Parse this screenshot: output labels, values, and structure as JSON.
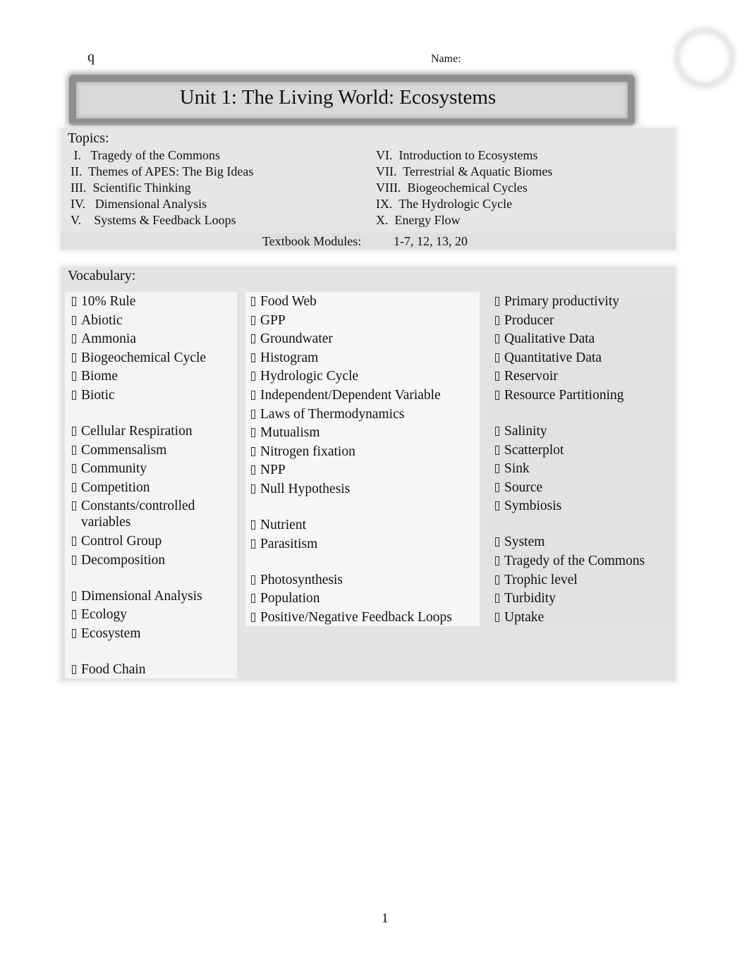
{
  "header": {
    "stray_char": "q",
    "name_label": "Name:",
    "title": "Unit 1: The Living World: Ecosystems"
  },
  "topics": {
    "heading": "Topics:",
    "left": [
      {
        "numeral": " I.",
        "label": "Tragedy of the Commons",
        "sep": "   "
      },
      {
        "numeral": "II.",
        "label": "Themes of APES: The Big Ideas",
        "sep": "  "
      },
      {
        "numeral": "III.",
        "label": "Scientific Thinking",
        "sep": "  "
      },
      {
        "numeral": "IV.",
        "label": "Dimensional Analysis",
        "sep": "   "
      },
      {
        "numeral": "V.",
        "label": "Systems & Feedback Loops",
        "sep": "    "
      }
    ],
    "right": [
      {
        "numeral": "VI.",
        "label": "Introduction to Ecosystems",
        "sep": "  "
      },
      {
        "numeral": "VII.",
        "label": "Terrestrial & Aquatic Biomes",
        "sep": "  "
      },
      {
        "numeral": "VIII.",
        "label": "Biogeochemical Cycles",
        "sep": "  "
      },
      {
        "numeral": "IX.",
        "label": "The Hydrologic Cycle",
        "sep": "  "
      },
      {
        "numeral": "X.",
        "label": "Energy Flow",
        "sep": "  "
      }
    ],
    "modules_label": "Textbook Modules:",
    "modules_value": "1-7, 12, 13, 20"
  },
  "vocabulary": {
    "heading": "Vocabulary:",
    "bullet_icon": "checkbox-icon",
    "columns": [
      [
        {
          "term": "10% Rule"
        },
        {
          "term": "Abiotic"
        },
        {
          "term": "Ammonia"
        },
        {
          "term": "Biogeochemical Cycle"
        },
        {
          "term": "Biome"
        },
        {
          "term": "Biotic",
          "pad": true
        },
        {
          "term": "Cellular Respiration"
        },
        {
          "term": "Commensalism"
        },
        {
          "term": "Community"
        },
        {
          "term": "Competition"
        },
        {
          "term": "Constants/controlled variables"
        },
        {
          "term": "Control Group"
        },
        {
          "term": "Decomposition",
          "pad": true
        },
        {
          "term": "Dimensional Analysis"
        },
        {
          "term": "Ecology"
        },
        {
          "term": "Ecosystem",
          "pad": true
        },
        {
          "term": "Food Chain"
        }
      ],
      [
        {
          "term": "Food Web"
        },
        {
          "term": "GPP"
        },
        {
          "term": "Groundwater"
        },
        {
          "term": "Histogram"
        },
        {
          "term": "Hydrologic Cycle"
        },
        {
          "term": "Independent/Dependent Variable"
        },
        {
          "term": "Laws of Thermodynamics"
        },
        {
          "term": "Mutualism"
        },
        {
          "term": "Nitrogen fixation"
        },
        {
          "term": "NPP"
        },
        {
          "term": "Null Hypothesis",
          "pad": true
        },
        {
          "term": "Nutrient"
        },
        {
          "term": "Parasitism",
          "pad": true
        },
        {
          "term": "Photosynthesis"
        },
        {
          "term": "Population"
        },
        {
          "term": "Positive/Negative Feedback Loops"
        }
      ],
      [
        {
          "term": "Primary productivity"
        },
        {
          "term": "Producer"
        },
        {
          "term": "Qualitative Data"
        },
        {
          "term": "Quantitative Data"
        },
        {
          "term": "Reservoir"
        },
        {
          "term": "Resource Partitioning",
          "pad": true
        },
        {
          "term": "Salinity"
        },
        {
          "term": "Scatterplot"
        },
        {
          "term": "Sink"
        },
        {
          "term": "Source"
        },
        {
          "term": "Symbiosis",
          "pad": true
        },
        {
          "term": "System"
        },
        {
          "term": "Tragedy of the Commons"
        },
        {
          "term": "Trophic level"
        },
        {
          "term": "Turbidity"
        },
        {
          "term": "Uptake"
        }
      ]
    ]
  },
  "footer": {
    "page_number": "1"
  }
}
